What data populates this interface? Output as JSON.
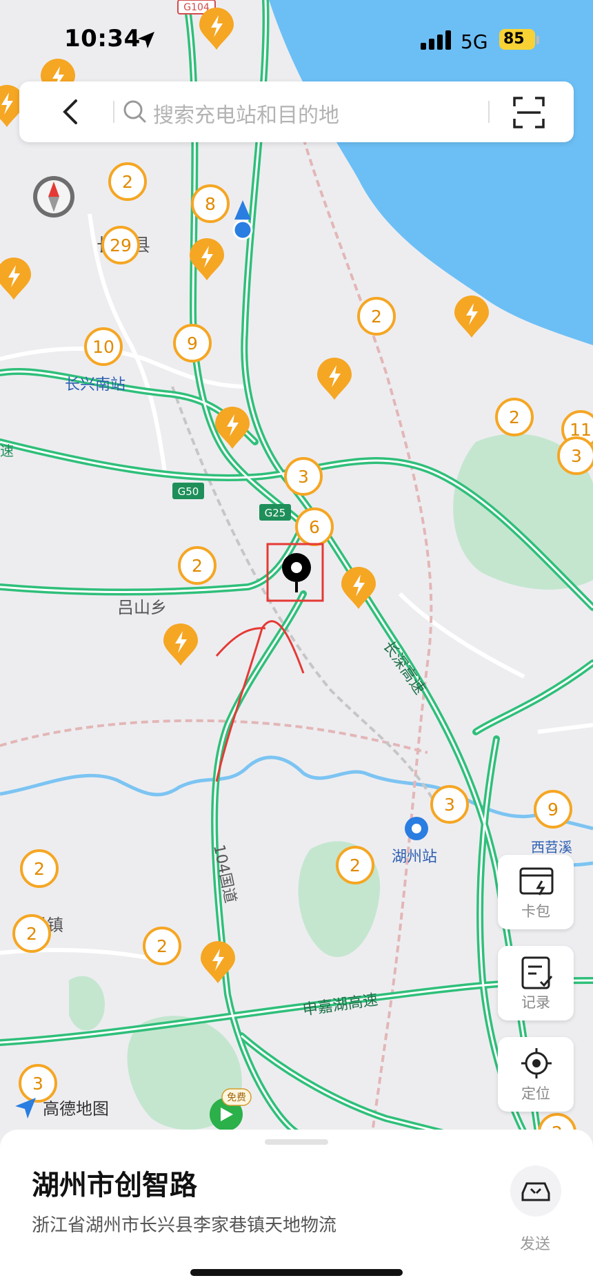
{
  "status_bar": {
    "time": "10:34",
    "network": "5G",
    "battery": "85"
  },
  "search": {
    "placeholder": "搜索充电站和目的地"
  },
  "map": {
    "labels": {
      "changxing_county": "长兴县",
      "changxing_south": "长兴南站",
      "g50": "G50",
      "g25": "G25",
      "g104": "G104",
      "lvshan": "吕山乡",
      "changshen": "长深高速",
      "national_104": "104国道",
      "huzhou_station": "湖州站",
      "xitiaoxi": "西苕溪",
      "shenjiahu": "申嘉湖高速",
      "town": "乔镇",
      "highway_left": "速",
      "free_badge": "免费",
      "logo": "高德地图"
    },
    "clusters": [
      "2",
      "8",
      "29",
      "10",
      "9",
      "2",
      "2",
      "11",
      "3",
      "3",
      "6",
      "2",
      "2",
      "3",
      "9",
      "2",
      "2",
      "2",
      "3",
      "2"
    ]
  },
  "side_buttons": {
    "wallet": "卡包",
    "records": "记录",
    "locate": "定位"
  },
  "destination": {
    "name": "湖州市创智路",
    "address": "浙江省湖州市长兴县李家巷镇天地物流",
    "send_label": "发送"
  },
  "colors": {
    "road": "#2fbf7a",
    "water": "#66b8f2",
    "cluster": "#f5a623",
    "marker_box": "#e53935"
  }
}
